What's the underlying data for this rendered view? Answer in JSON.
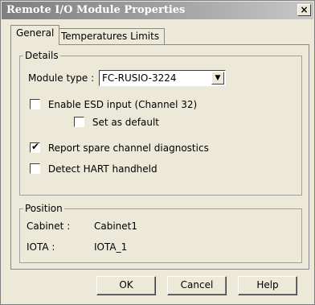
{
  "window": {
    "title": "Remote I/O Module Properties",
    "close_label": "×"
  },
  "tabs": [
    {
      "label": "General",
      "active": true
    },
    {
      "label": "Temperatures Limits",
      "active": false
    }
  ],
  "details": {
    "group_label": "Details",
    "module_type_label": "Module type :",
    "module_type_value": "FC-RUSIO-3224",
    "enable_esd_label": "Enable ESD input (Channel 32)",
    "enable_esd_checked": false,
    "set_default_label": "Set as default",
    "set_default_checked": false,
    "report_spare_label": "Report spare channel diagnostics",
    "report_spare_checked": true,
    "detect_hart_label": "Detect HART handheld",
    "detect_hart_checked": false
  },
  "position": {
    "group_label": "Position",
    "cabinet_label": "Cabinet :",
    "cabinet_value": "Cabinet1",
    "iota_label": "IOTA :",
    "iota_value": "IOTA_1"
  },
  "buttons": {
    "ok": "OK",
    "cancel": "Cancel",
    "help": "Help"
  },
  "icons": {
    "checkmark": "✔",
    "dropdown": "▼"
  }
}
